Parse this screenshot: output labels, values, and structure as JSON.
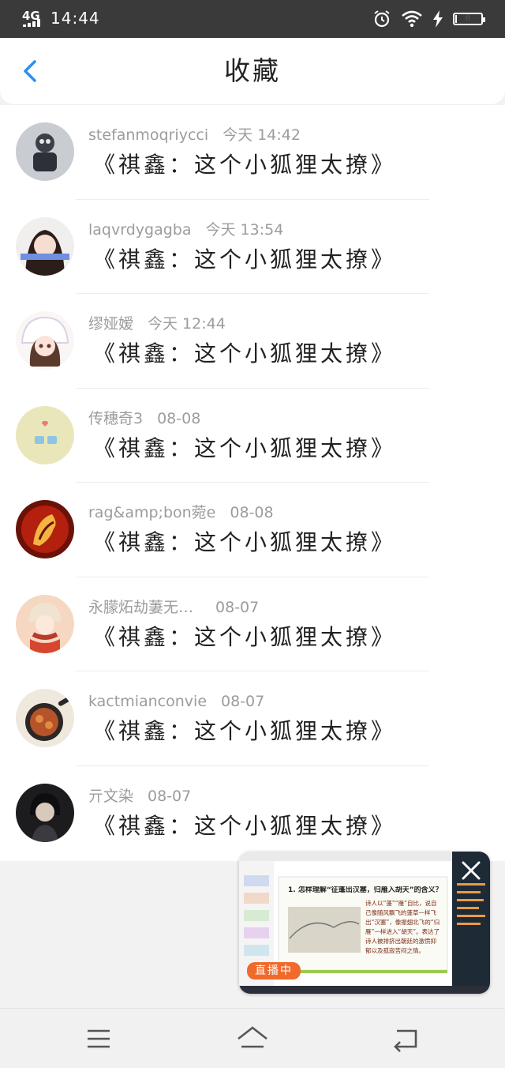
{
  "status_bar": {
    "network": "4G",
    "time": "14:44",
    "battery_level": 6,
    "icons": [
      "alarm-icon",
      "wifi-icon",
      "charging-icon",
      "battery-icon"
    ]
  },
  "header": {
    "title": "收藏",
    "back_icon": "chevron-left-icon"
  },
  "favorites": [
    {
      "user": "stefanmoqriycci",
      "time": "今天 14:42",
      "title": "《祺鑫：这个小狐狸太撩》"
    },
    {
      "user": "laqvrdygagba",
      "time": "今天 13:54",
      "title": "《祺鑫：这个小狐狸太撩》"
    },
    {
      "user": "缪娅嫒",
      "time": "今天 12:44",
      "title": "《祺鑫：这个小狐狸太撩》"
    },
    {
      "user": "传穗奇3",
      "time": "08-08",
      "title": "《祺鑫：这个小狐狸太撩》"
    },
    {
      "user": "rag&amp;bon菀e",
      "time": "08-08",
      "title": "《祺鑫：这个小狐狸太撩》"
    },
    {
      "user": "永朦炻劫萋无…",
      "time": "08-07",
      "title": "《祺鑫：这个小狐狸太撩》"
    },
    {
      "user": "kactmianconvie",
      "time": "08-07",
      "title": "《祺鑫：这个小狐狸太撩》"
    },
    {
      "user": "亓文染",
      "time": "08-07",
      "title": "《祺鑫：这个小狐狸太撩》"
    }
  ],
  "live_pip": {
    "badge": "直播中",
    "slide_question": "1. 怎样理解“征蓬出汉塞，归雁入胡天”的含义？",
    "slide_text": "诗人以“蓬”“雁”自比，说自己像随风飘飞的蓬草一样飞出“汉塞”，像振翅北飞的“归雁”一样进入“胡天”。表达了诗人被排挤出朝廷的激愤抑郁以及孤寂苦闷之情。",
    "close_icon": "close-icon"
  },
  "nav_bar": {
    "items": [
      "menu-icon",
      "home-icon",
      "back-icon"
    ]
  },
  "colors": {
    "accent": "#2a8ff0",
    "status_bar": "#3a3a3a",
    "live_badge": "#f06a2b",
    "meta_text": "#9c9c9c"
  }
}
